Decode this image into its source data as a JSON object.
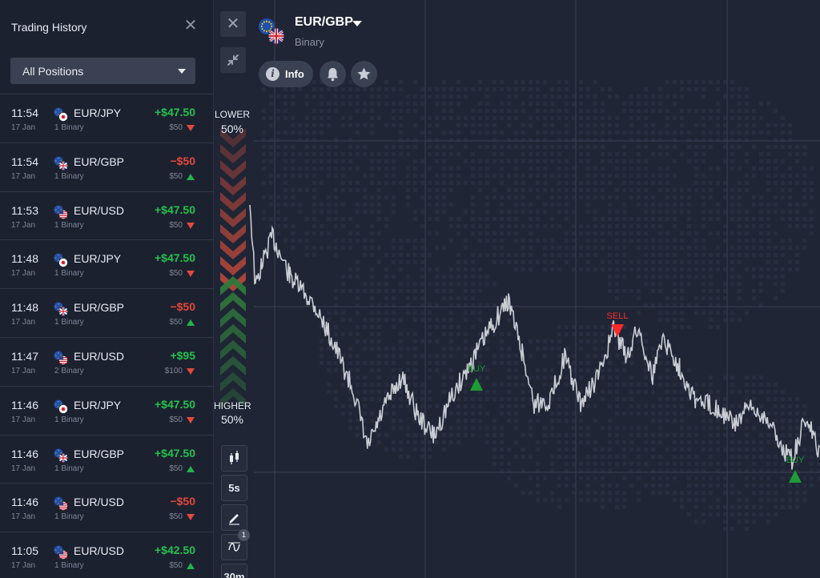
{
  "sidebar": {
    "title": "Trading History",
    "filter": "All Positions",
    "positions": [
      {
        "time": "11:54",
        "date": "17 Jan",
        "pair": "EUR/JPY",
        "type": "1 Binary",
        "profit": "+$47.50",
        "amount": "$50",
        "direction": "down",
        "outcome": "win",
        "flag": "jpy-flag-icon"
      },
      {
        "time": "11:54",
        "date": "17 Jan",
        "pair": "EUR/GBP",
        "type": "1 Binary",
        "profit": "−$50",
        "amount": "$50",
        "direction": "up",
        "outcome": "loss",
        "flag": "gbp-flag-icon"
      },
      {
        "time": "11:53",
        "date": "17 Jan",
        "pair": "EUR/USD",
        "type": "1 Binary",
        "profit": "+$47.50",
        "amount": "$50",
        "direction": "down",
        "outcome": "win",
        "flag": "usd-flag-icon"
      },
      {
        "time": "11:48",
        "date": "17 Jan",
        "pair": "EUR/JPY",
        "type": "1 Binary",
        "profit": "+$47.50",
        "amount": "$50",
        "direction": "down",
        "outcome": "win",
        "flag": "jpy-flag-icon"
      },
      {
        "time": "11:48",
        "date": "17 Jan",
        "pair": "EUR/GBP",
        "type": "1 Binary",
        "profit": "−$50",
        "amount": "$50",
        "direction": "up",
        "outcome": "loss",
        "flag": "gbp-flag-icon"
      },
      {
        "time": "11:47",
        "date": "17 Jan",
        "pair": "EUR/USD",
        "type": "2 Binary",
        "profit": "+$95",
        "amount": "$100",
        "direction": "down",
        "outcome": "win",
        "flag": "usd-flag-icon"
      },
      {
        "time": "11:46",
        "date": "17 Jan",
        "pair": "EUR/JPY",
        "type": "1 Binary",
        "profit": "+$47.50",
        "amount": "$50",
        "direction": "down",
        "outcome": "win",
        "flag": "jpy-flag-icon"
      },
      {
        "time": "11:46",
        "date": "17 Jan",
        "pair": "EUR/GBP",
        "type": "1 Binary",
        "profit": "+$47.50",
        "amount": "$50",
        "direction": "up",
        "outcome": "win",
        "flag": "gbp-flag-icon"
      },
      {
        "time": "11:46",
        "date": "17 Jan",
        "pair": "EUR/USD",
        "type": "1 Binary",
        "profit": "−$50",
        "amount": "$50",
        "direction": "down",
        "outcome": "loss",
        "flag": "usd-flag-icon"
      },
      {
        "time": "11:05",
        "date": "17 Jan",
        "pair": "EUR/USD",
        "type": "1 Binary",
        "profit": "+$42.50",
        "amount": "$50",
        "direction": "up",
        "outcome": "win",
        "flag": "usd-flag-icon"
      }
    ]
  },
  "asset": {
    "name": "EUR/GBP",
    "type": "Binary",
    "info_label": "Info"
  },
  "sentiment": {
    "lower_label": "LOWER",
    "lower_pct": "50%",
    "higher_label": "HIGHER",
    "higher_pct": "50%"
  },
  "tools": {
    "interval": "5s",
    "timeframe": "30m",
    "indicator_count": "1"
  },
  "markers": {
    "sell": "SELL",
    "buy": "BUY"
  },
  "colors": {
    "win": "#24c24c",
    "loss": "#e5473a",
    "up": "#24b24a",
    "down": "#e04a3c",
    "price_line": "#c9ccd3",
    "sell_marker": "#ff2a2a",
    "buy_marker": "#1e9b34"
  }
}
